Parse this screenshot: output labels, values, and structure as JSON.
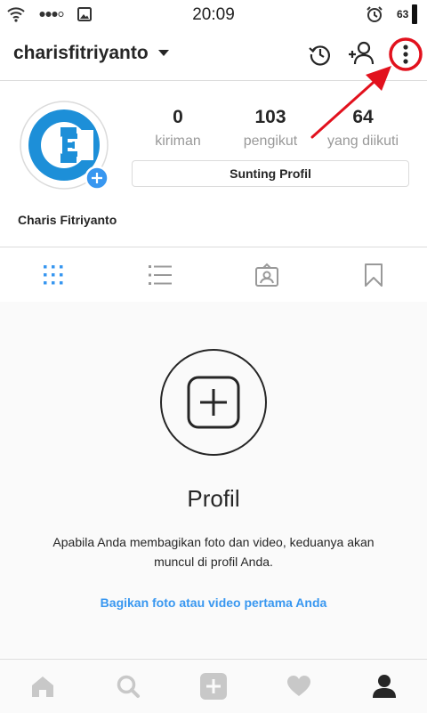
{
  "status_bar": {
    "time": "20:09",
    "battery": "63",
    "icons": [
      "wifi-icon",
      "signal-dots-icon",
      "image-notification-icon",
      "alarm-icon",
      "battery-icon"
    ]
  },
  "header": {
    "username": "charisfitriyanto",
    "icons": [
      "history-icon",
      "add-person-icon",
      "more-options-icon"
    ],
    "annotation_color": "#e2111d"
  },
  "profile": {
    "avatar_icon": "logo-avatar",
    "stats": [
      {
        "value": "0",
        "label": "kiriman"
      },
      {
        "value": "103",
        "label": "pengikut"
      },
      {
        "value": "64",
        "label": "yang diikuti"
      }
    ],
    "edit_button": "Sunting Profil",
    "full_name": "Charis Fitriyanto"
  },
  "tabs": [
    "grid-icon",
    "list-icon",
    "tagged-icon",
    "saved-icon"
  ],
  "empty_state": {
    "title": "Profil",
    "description": "Apabila Anda membagikan foto dan video, keduanya akan muncul di profil Anda.",
    "link": "Bagikan foto atau video pertama Anda"
  },
  "bottom_nav": [
    "home-icon",
    "search-icon",
    "add-post-icon",
    "activity-heart-icon",
    "profile-icon"
  ],
  "colors": {
    "accent_blue": "#3897f0",
    "logo_blue": "#1d8fd8",
    "text": "#262626",
    "muted": "#999999",
    "border": "#dbdbdb"
  }
}
